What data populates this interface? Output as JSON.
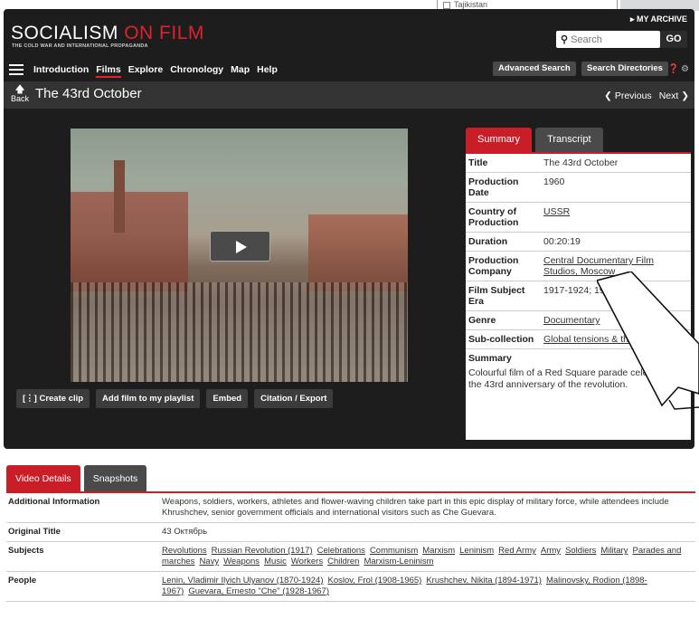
{
  "overlay": {
    "tajikistan": "Tajikistan"
  },
  "site": {
    "brand_main": "SOCIALISM ",
    "brand_on": "ON FILM",
    "tagline": "THE COLD WAR AND INTERNATIONAL PROPAGANDA",
    "my_archive": "▸ MY ARCHIVE",
    "search_placeholder": "Search",
    "go_label": "GO"
  },
  "nav": {
    "links": [
      "Introduction",
      "Films",
      "Explore",
      "Chronology",
      "Map",
      "Help"
    ],
    "active": "Films",
    "advanced_search": "Advanced Search",
    "search_directories": "Search Directories"
  },
  "titlebar": {
    "back": "Back",
    "title": "The 43rd October",
    "previous": "❮ Previous",
    "next": "Next ❯"
  },
  "toolbar": {
    "create_clip": "Create clip",
    "add_playlist": "Add film to my playlist",
    "embed": "Embed",
    "citation": "Citation / Export"
  },
  "summary_tabs": [
    "Summary",
    "Transcript"
  ],
  "summary": [
    {
      "label": "Title",
      "value": "The 43rd October",
      "link": false
    },
    {
      "label": "Production Date",
      "value": "1960",
      "link": false
    },
    {
      "label": "Country of Production",
      "value": "USSR",
      "link": true
    },
    {
      "label": "Duration",
      "value": "00:20:19",
      "link": false
    },
    {
      "label": "Production Company",
      "value": "Central Documentary Film Studios, Moscow",
      "link": true
    },
    {
      "label": "Film Subject Era",
      "value": "1917-1924; 19",
      "link": false
    },
    {
      "label": "Genre",
      "value": "Documentary",
      "link": true
    },
    {
      "label": "Sub-collection",
      "value": "Global tensions & the Cold W",
      "link": true
    }
  ],
  "summary_heading": "Summary",
  "summary_text": "Colourful film of a Red Square parade celebrating the 43rd anniversary of the revolution.",
  "details_tabs": [
    "Video Details",
    "Snapshots"
  ],
  "details": {
    "additional_label": "Additional Information",
    "additional_text": "Weapons, soldiers, workers, athletes and flower-waving children take part in this epic display of military force, while attendees include Khrushchev, senior government officials and international visitors such as Che Guevara.",
    "original_label": "Original Title",
    "original_text": "43 Октябрь",
    "subjects_label": "Subjects",
    "subjects": [
      "Revolutions",
      "Russian Revolution (1917)",
      "Celebrations",
      "Communism",
      "Marxism",
      "Leninism",
      "Red Army",
      "Army",
      "Soldiers",
      "Military",
      "Parades and marches",
      "Navy",
      "Weapons",
      "Music",
      "Workers",
      "Children",
      "Marxism-Leninism"
    ],
    "people_label": "People",
    "people": [
      "Lenin, Vladimir Ilyich Ulyanov (1870-1924)",
      "Koslov, Frol (1908-1965)",
      "Krushchev, Nikita (1894-1971)",
      "Malinovsky, Rodion (1898-1967)",
      "Guevara, Ernesto \"Che\" (1928-1967)"
    ]
  }
}
